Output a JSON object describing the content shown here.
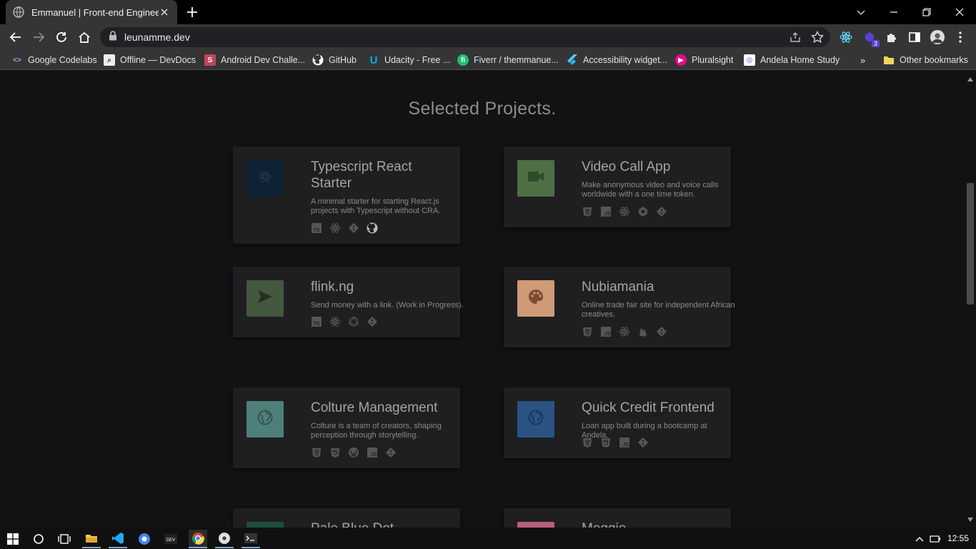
{
  "browser": {
    "tab_title": "Emmanuel | Front-end Engineer",
    "url": "leunamme.dev",
    "extension_badge": "3"
  },
  "bookmarks": [
    {
      "label": "Google Codelabs",
      "icon": "code-brackets-icon"
    },
    {
      "label": "Offline — DevDocs",
      "icon": "devdocs-icon"
    },
    {
      "label": "Android Dev Challe...",
      "icon": "android-challenge-icon"
    },
    {
      "label": "GitHub",
      "icon": "github-icon"
    },
    {
      "label": "Udacity - Free ...",
      "icon": "udacity-icon"
    },
    {
      "label": "Fiverr / themmanue...",
      "icon": "fiverr-icon"
    },
    {
      "label": "Accessibility widget...",
      "icon": "flutter-icon"
    },
    {
      "label": "Pluralsight",
      "icon": "pluralsight-icon"
    },
    {
      "label": "Andela Home Study",
      "icon": "andela-icon"
    }
  ],
  "other_bookmarks": "Other bookmarks",
  "page": {
    "section_title": "Selected Projects.",
    "projects": [
      {
        "title": "Typescript React Starter",
        "desc": "A minimal starter for starting React.js projects with Typescript without CRA.",
        "color": "#0f2233",
        "icon": "react-outline-icon",
        "stack": [
          "typescript-icon",
          "react-icon",
          "git-icon",
          "github-icon"
        ]
      },
      {
        "title": "Video Call App",
        "desc": "Make anonymous video and voice calls worldwide with a one time token.",
        "color": "#4f6f47",
        "icon": "video-camera-icon",
        "stack": [
          "html5-icon",
          "javascript-icon",
          "react-icon",
          "apollo-icon",
          "git-icon"
        ]
      },
      {
        "title": "flink.ng",
        "desc": "Send money with a link. (Work in Progress).",
        "color": "#44573f",
        "icon": "send-icon",
        "stack": [
          "typescript-icon",
          "react-icon",
          "graphql-icon",
          "git-icon"
        ]
      },
      {
        "title": "Nubiamania",
        "desc": "Online trade fair site for independent African creatives.",
        "color": "#d09a78",
        "icon": "palette-icon",
        "stack": [
          "html5-icon",
          "javascript-icon",
          "react-icon",
          "firebase-icon",
          "git-icon"
        ]
      },
      {
        "title": "Colture Management",
        "desc": "Colture is a team of creators, shaping perception through storytelling.",
        "color": "#4f7f7a",
        "icon": "globe-icon",
        "stack": [
          "html5-icon",
          "css3-icon",
          "wordpress-icon",
          "javascript-icon",
          "git-icon"
        ]
      },
      {
        "title": "Quick Credit Frontend",
        "desc": "Loan app built during a bootcamp at Andela.",
        "color": "#2a5384",
        "icon": "globe-icon",
        "stack": [
          "html5-icon",
          "css3-icon",
          "javascript-icon",
          "git-icon"
        ]
      },
      {
        "title": "Pale Blue Dot",
        "desc": "",
        "color": "#1e4d3a",
        "icon": "globe-icon",
        "stack": []
      },
      {
        "title": "Meggie",
        "desc": "",
        "color": "#b8607e",
        "icon": "globe-icon",
        "stack": []
      }
    ]
  },
  "taskbar": {
    "clock": "12:55"
  }
}
